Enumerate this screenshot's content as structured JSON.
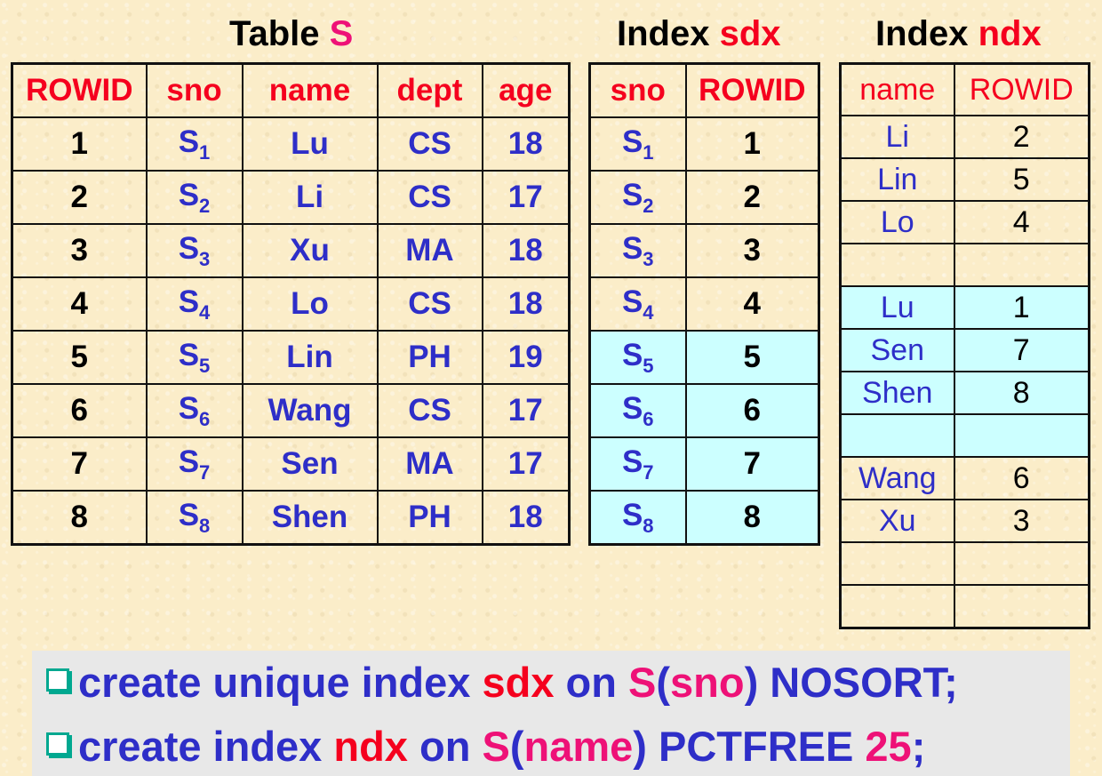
{
  "titles": {
    "table_s": {
      "prefix": "Table ",
      "name": "S"
    },
    "index_sdx": {
      "prefix": "Index ",
      "name": "sdx"
    },
    "index_ndx": {
      "prefix": "Index ",
      "name": "ndx"
    }
  },
  "table_s": {
    "headers": [
      "ROWID",
      "sno",
      "name",
      "dept",
      "age"
    ],
    "rows": [
      {
        "rowid": "1",
        "sno": "S",
        "sub": "1",
        "name": "Lu",
        "dept": "CS",
        "age": "18"
      },
      {
        "rowid": "2",
        "sno": "S",
        "sub": "2",
        "name": "Li",
        "dept": "CS",
        "age": "17"
      },
      {
        "rowid": "3",
        "sno": "S",
        "sub": "3",
        "name": "Xu",
        "dept": "MA",
        "age": "18"
      },
      {
        "rowid": "4",
        "sno": "S",
        "sub": "4",
        "name": "Lo",
        "dept": "CS",
        "age": "18"
      },
      {
        "rowid": "5",
        "sno": "S",
        "sub": "5",
        "name": "Lin",
        "dept": "PH",
        "age": "19"
      },
      {
        "rowid": "6",
        "sno": "S",
        "sub": "6",
        "name": "Wang",
        "dept": "CS",
        "age": "17"
      },
      {
        "rowid": "7",
        "sno": "S",
        "sub": "7",
        "name": "Sen",
        "dept": "MA",
        "age": "17"
      },
      {
        "rowid": "8",
        "sno": "S",
        "sub": "8",
        "name": "Shen",
        "dept": "PH",
        "age": "18"
      }
    ]
  },
  "index_sdx": {
    "headers": [
      "sno",
      "ROWID"
    ],
    "rows": [
      {
        "sno": "S",
        "sub": "1",
        "rowid": "1",
        "highlight": false
      },
      {
        "sno": "S",
        "sub": "2",
        "rowid": "2",
        "highlight": false
      },
      {
        "sno": "S",
        "sub": "3",
        "rowid": "3",
        "highlight": false
      },
      {
        "sno": "S",
        "sub": "4",
        "rowid": "4",
        "highlight": false
      },
      {
        "sno": "S",
        "sub": "5",
        "rowid": "5",
        "highlight": true
      },
      {
        "sno": "S",
        "sub": "6",
        "rowid": "6",
        "highlight": true
      },
      {
        "sno": "S",
        "sub": "7",
        "rowid": "7",
        "highlight": true
      },
      {
        "sno": "S",
        "sub": "8",
        "rowid": "8",
        "highlight": true
      }
    ]
  },
  "index_ndx": {
    "headers": [
      "name",
      "ROWID"
    ],
    "rows": [
      {
        "name": "Li",
        "rowid": "2",
        "highlight": false
      },
      {
        "name": "Lin",
        "rowid": "5",
        "highlight": false
      },
      {
        "name": "Lo",
        "rowid": "4",
        "highlight": false
      },
      {
        "name": "",
        "rowid": "",
        "highlight": false
      },
      {
        "name": "Lu",
        "rowid": "1",
        "highlight": true
      },
      {
        "name": "Sen",
        "rowid": "7",
        "highlight": true
      },
      {
        "name": "Shen",
        "rowid": "8",
        "highlight": true
      },
      {
        "name": "",
        "rowid": "",
        "highlight": true
      },
      {
        "name": "Wang",
        "rowid": "6",
        "highlight": false
      },
      {
        "name": "Xu",
        "rowid": "3",
        "highlight": false
      },
      {
        "name": "",
        "rowid": "",
        "highlight": false
      },
      {
        "name": "",
        "rowid": "",
        "highlight": false
      }
    ]
  },
  "commands": {
    "line1": {
      "p1": "create unique index ",
      "idx": "sdx",
      "p2": " on ",
      "tbl": "S",
      "lp": "(",
      "col": "sno",
      "rp": ") NOSORT;"
    },
    "line2": {
      "p1": "create index ",
      "idx": "ndx",
      "p2": " on ",
      "tbl": "S",
      "lp": "(",
      "col": "name",
      "rp": ") PCTFREE ",
      "num": "25",
      "end": ";"
    }
  },
  "colors": {
    "header_red": "#f5001e",
    "text_blue": "#2e2ec8",
    "magenta": "#ee1177",
    "highlight_cyan": "#ccffff",
    "command_bg": "#e8e8e8",
    "bullet_teal": "#00a890"
  }
}
